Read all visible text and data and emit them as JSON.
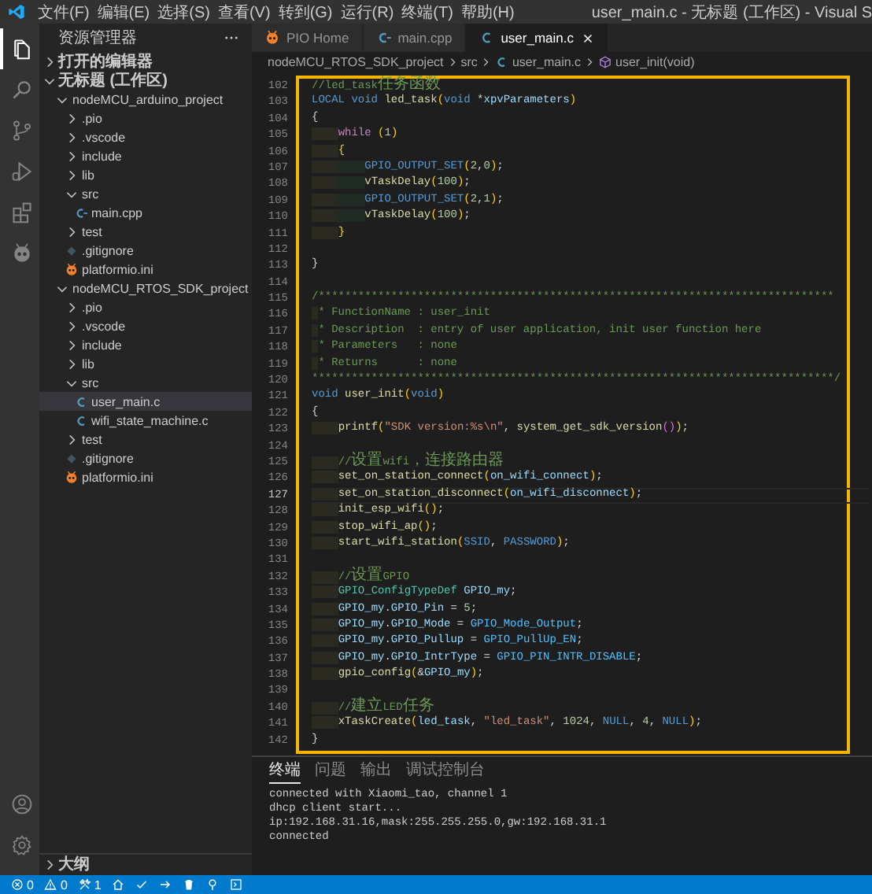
{
  "title_bar": {
    "menu": [
      "文件(F)",
      "编辑(E)",
      "选择(S)",
      "查看(V)",
      "转到(G)",
      "运行(R)",
      "终端(T)",
      "帮助(H)"
    ],
    "title": "user_main.c - 无标题 (工作区) - Visual S"
  },
  "activity_bar": {
    "top": [
      {
        "kind": "explorer",
        "selected": true
      },
      {
        "kind": "search",
        "selected": false
      },
      {
        "kind": "scm",
        "selected": false
      },
      {
        "kind": "run",
        "selected": false
      },
      {
        "kind": "extensions",
        "selected": false
      },
      {
        "kind": "platformio",
        "selected": false
      }
    ],
    "bottom": [
      {
        "kind": "account"
      },
      {
        "kind": "settings"
      }
    ]
  },
  "sidebar": {
    "title": "资源管理器",
    "sections": [
      {
        "label": "打开的编辑器",
        "expanded": false
      },
      {
        "label": "无标题 (工作区)",
        "expanded": true,
        "children": [
          {
            "label": "nodeMCU_arduino_project",
            "kind": "folder",
            "expanded": true,
            "selected": false,
            "children": [
              {
                "label": ".pio",
                "kind": "folder",
                "expanded": false,
                "selected": false
              },
              {
                "label": ".vscode",
                "kind": "folder",
                "expanded": false,
                "selected": false
              },
              {
                "label": "include",
                "kind": "folder",
                "expanded": false,
                "selected": false
              },
              {
                "label": "lib",
                "kind": "folder",
                "expanded": false,
                "selected": false
              },
              {
                "label": "src",
                "kind": "folder",
                "expanded": true,
                "selected": false,
                "children": [
                  {
                    "label": "main.cpp",
                    "kind": "cpp",
                    "selected": false
                  }
                ]
              },
              {
                "label": "test",
                "kind": "folder",
                "expanded": false,
                "selected": false
              },
              {
                "label": ".gitignore",
                "kind": "git",
                "selected": false
              },
              {
                "label": "platformio.ini",
                "kind": "pio",
                "selected": false
              }
            ]
          },
          {
            "label": "nodeMCU_RTOS_SDK_project",
            "kind": "folder",
            "expanded": true,
            "selected": false,
            "children": [
              {
                "label": ".pio",
                "kind": "folder",
                "expanded": false,
                "selected": false
              },
              {
                "label": ".vscode",
                "kind": "folder",
                "expanded": false,
                "selected": false
              },
              {
                "label": "include",
                "kind": "folder",
                "expanded": false,
                "selected": false
              },
              {
                "label": "lib",
                "kind": "folder",
                "expanded": false,
                "selected": false
              },
              {
                "label": "src",
                "kind": "folder",
                "expanded": true,
                "selected": false,
                "children": [
                  {
                    "label": "user_main.c",
                    "kind": "c",
                    "selected": true
                  },
                  {
                    "label": "wifi_state_machine.c",
                    "kind": "c",
                    "selected": false
                  }
                ]
              },
              {
                "label": "test",
                "kind": "folder",
                "expanded": false,
                "selected": false
              },
              {
                "label": ".gitignore",
                "kind": "git",
                "selected": false
              },
              {
                "label": "platformio.ini",
                "kind": "pio",
                "selected": false
              }
            ]
          }
        ]
      },
      {
        "label": "大纲",
        "expanded": false
      }
    ]
  },
  "tabs": [
    {
      "label": "PIO Home",
      "kind": "pio",
      "selected": false
    },
    {
      "label": "main.cpp",
      "kind": "cpp",
      "selected": false
    },
    {
      "label": "user_main.c",
      "kind": "c",
      "selected": true
    }
  ],
  "breadcrumb": [
    {
      "kind": "folder",
      "text": "nodeMCU_RTOS_SDK_project"
    },
    {
      "kind": "folder",
      "text": "src"
    },
    {
      "kind": "c",
      "text": "user_main.c"
    },
    {
      "kind": "function",
      "text": "user_init(void)"
    }
  ],
  "editor": {
    "lines": [
      {
        "number": "102",
        "current": false,
        "tokens": [
          {
            "kind": "comment",
            "text": "//led_task任务函数"
          }
        ]
      },
      {
        "number": "103",
        "current": false,
        "tokens": [
          {
            "kind": "keyword",
            "text": "LOCAL void "
          },
          {
            "kind": "func",
            "text": "led_task"
          },
          {
            "kind": "bracket",
            "text": "("
          },
          {
            "kind": "keyword",
            "text": "void"
          },
          {
            "kind": "plain",
            "text": " *"
          },
          {
            "kind": "var",
            "text": "xpvParameters"
          },
          {
            "kind": "bracket",
            "text": ")"
          }
        ]
      },
      {
        "number": "104",
        "current": false,
        "tokens": [
          {
            "kind": "plain",
            "text": "{"
          }
        ]
      },
      {
        "number": "105",
        "current": false,
        "tokens": [
          {
            "kind": "control",
            "text": "    while "
          },
          {
            "kind": "bracket",
            "text": "("
          },
          {
            "kind": "number",
            "text": "1"
          },
          {
            "kind": "bracket",
            "text": ")"
          }
        ]
      },
      {
        "number": "106",
        "current": false,
        "tokens": [
          {
            "kind": "bracket",
            "text": "    {"
          }
        ]
      },
      {
        "number": "107",
        "current": false,
        "tokens": [
          {
            "kind": "macro",
            "text": "        GPIO_OUTPUT_SET"
          },
          {
            "kind": "bracket",
            "text": "("
          },
          {
            "kind": "number",
            "text": "2"
          },
          {
            "kind": "plain",
            "text": ","
          },
          {
            "kind": "number",
            "text": "0"
          },
          {
            "kind": "bracket",
            "text": ")"
          },
          {
            "kind": "plain",
            "text": ";"
          }
        ]
      },
      {
        "number": "108",
        "current": false,
        "tokens": [
          {
            "kind": "func",
            "text": "        vTaskDelay"
          },
          {
            "kind": "bracket",
            "text": "("
          },
          {
            "kind": "number",
            "text": "100"
          },
          {
            "kind": "bracket",
            "text": ")"
          },
          {
            "kind": "plain",
            "text": ";"
          }
        ]
      },
      {
        "number": "109",
        "current": false,
        "tokens": [
          {
            "kind": "macro",
            "text": "        GPIO_OUTPUT_SET"
          },
          {
            "kind": "bracket",
            "text": "("
          },
          {
            "kind": "number",
            "text": "2"
          },
          {
            "kind": "plain",
            "text": ","
          },
          {
            "kind": "number",
            "text": "1"
          },
          {
            "kind": "bracket",
            "text": ")"
          },
          {
            "kind": "plain",
            "text": ";"
          }
        ]
      },
      {
        "number": "110",
        "current": false,
        "tokens": [
          {
            "kind": "func",
            "text": "        vTaskDelay"
          },
          {
            "kind": "bracket",
            "text": "("
          },
          {
            "kind": "number",
            "text": "100"
          },
          {
            "kind": "bracket",
            "text": ")"
          },
          {
            "kind": "plain",
            "text": ";"
          }
        ]
      },
      {
        "number": "111",
        "current": false,
        "tokens": [
          {
            "kind": "bracket",
            "text": "    }"
          }
        ]
      },
      {
        "number": "112",
        "current": false
      },
      {
        "number": "113",
        "current": false,
        "tokens": [
          {
            "kind": "plain",
            "text": "}"
          }
        ]
      },
      {
        "number": "114",
        "current": false
      },
      {
        "number": "115",
        "current": false,
        "tokens": [
          {
            "kind": "comment",
            "text": "/******************************************************************************"
          }
        ]
      },
      {
        "number": "116",
        "current": false,
        "tokens": [
          {
            "kind": "comment",
            "text": " * FunctionName : user_init"
          }
        ]
      },
      {
        "number": "117",
        "current": false,
        "tokens": [
          {
            "kind": "comment",
            "text": " * Description  : entry of user application, init user function here"
          }
        ]
      },
      {
        "number": "118",
        "current": false,
        "tokens": [
          {
            "kind": "comment",
            "text": " * Parameters   : none"
          }
        ]
      },
      {
        "number": "119",
        "current": false,
        "tokens": [
          {
            "kind": "comment",
            "text": " * Returns      : none"
          }
        ]
      },
      {
        "number": "120",
        "current": false,
        "tokens": [
          {
            "kind": "comment",
            "text": "*******************************************************************************/"
          }
        ]
      },
      {
        "number": "121",
        "current": false,
        "tokens": [
          {
            "kind": "keyword",
            "text": "void "
          },
          {
            "kind": "func",
            "text": "user_init"
          },
          {
            "kind": "bracket",
            "text": "("
          },
          {
            "kind": "keyword",
            "text": "void"
          },
          {
            "kind": "bracket",
            "text": ")"
          }
        ]
      },
      {
        "number": "122",
        "current": false,
        "tokens": [
          {
            "kind": "plain",
            "text": "{"
          }
        ]
      },
      {
        "number": "123",
        "current": false,
        "tokens": [
          {
            "kind": "func",
            "text": "    printf"
          },
          {
            "kind": "bracket",
            "text": "("
          },
          {
            "kind": "string",
            "text": "\"SDK version:%s\\n\""
          },
          {
            "kind": "plain",
            "text": ", "
          },
          {
            "kind": "func",
            "text": "system_get_sdk_version"
          },
          {
            "kind": "bracket2",
            "text": "()"
          },
          {
            "kind": "bracket",
            "text": ")"
          },
          {
            "kind": "plain",
            "text": ";"
          }
        ]
      },
      {
        "number": "124",
        "current": false
      },
      {
        "number": "125",
        "current": false,
        "tokens": [
          {
            "kind": "comment",
            "text": "    //设置wifi，连接路由器"
          }
        ]
      },
      {
        "number": "126",
        "current": false,
        "tokens": [
          {
            "kind": "func",
            "text": "    set_on_station_connect"
          },
          {
            "kind": "bracket",
            "text": "("
          },
          {
            "kind": "var",
            "text": "on_wifi_connect"
          },
          {
            "kind": "bracket",
            "text": ")"
          },
          {
            "kind": "plain",
            "text": ";"
          }
        ]
      },
      {
        "number": "127",
        "current": true,
        "tokens": [
          {
            "kind": "func",
            "text": "    set_on_station_disconnect"
          },
          {
            "kind": "bracket",
            "text": "("
          },
          {
            "kind": "var",
            "text": "on_wifi_disconnect"
          },
          {
            "kind": "bracket",
            "text": ")"
          },
          {
            "kind": "plain",
            "text": ";"
          }
        ]
      },
      {
        "number": "128",
        "current": false,
        "tokens": [
          {
            "kind": "func",
            "text": "    init_esp_wifi"
          },
          {
            "kind": "bracket",
            "text": "()"
          },
          {
            "kind": "plain",
            "text": ";"
          }
        ]
      },
      {
        "number": "129",
        "current": false,
        "tokens": [
          {
            "kind": "func",
            "text": "    stop_wifi_ap"
          },
          {
            "kind": "bracket",
            "text": "()"
          },
          {
            "kind": "plain",
            "text": ";"
          }
        ]
      },
      {
        "number": "130",
        "current": false,
        "tokens": [
          {
            "kind": "func",
            "text": "    start_wifi_station"
          },
          {
            "kind": "bracket",
            "text": "("
          },
          {
            "kind": "macro",
            "text": "SSID"
          },
          {
            "kind": "plain",
            "text": ", "
          },
          {
            "kind": "macro",
            "text": "PASSWORD"
          },
          {
            "kind": "bracket",
            "text": ")"
          },
          {
            "kind": "plain",
            "text": ";"
          }
        ]
      },
      {
        "number": "131",
        "current": false
      },
      {
        "number": "132",
        "current": false,
        "tokens": [
          {
            "kind": "comment",
            "text": "    //设置GPIO"
          }
        ]
      },
      {
        "number": "133",
        "current": false,
        "tokens": [
          {
            "kind": "type",
            "text": "    GPIO_ConfigTypeDef "
          },
          {
            "kind": "var",
            "text": "GPIO_my"
          },
          {
            "kind": "plain",
            "text": ";"
          }
        ]
      },
      {
        "number": "134",
        "current": false,
        "tokens": [
          {
            "kind": "var",
            "text": "    GPIO_my"
          },
          {
            "kind": "plain",
            "text": "."
          },
          {
            "kind": "var",
            "text": "GPIO_Pin"
          },
          {
            "kind": "plain",
            "text": " = "
          },
          {
            "kind": "number",
            "text": "5"
          },
          {
            "kind": "plain",
            "text": ";"
          }
        ]
      },
      {
        "number": "135",
        "current": false,
        "tokens": [
          {
            "kind": "var",
            "text": "    GPIO_my"
          },
          {
            "kind": "plain",
            "text": "."
          },
          {
            "kind": "var",
            "text": "GPIO_Mode"
          },
          {
            "kind": "plain",
            "text": " = "
          },
          {
            "kind": "enum",
            "text": "GPIO_Mode_Output"
          },
          {
            "kind": "plain",
            "text": ";"
          }
        ]
      },
      {
        "number": "136",
        "current": false,
        "tokens": [
          {
            "kind": "var",
            "text": "    GPIO_my"
          },
          {
            "kind": "plain",
            "text": "."
          },
          {
            "kind": "var",
            "text": "GPIO_Pullup"
          },
          {
            "kind": "plain",
            "text": " = "
          },
          {
            "kind": "enum",
            "text": "GPIO_PullUp_EN"
          },
          {
            "kind": "plain",
            "text": ";"
          }
        ]
      },
      {
        "number": "137",
        "current": false,
        "tokens": [
          {
            "kind": "var",
            "text": "    GPIO_my"
          },
          {
            "kind": "plain",
            "text": "."
          },
          {
            "kind": "var",
            "text": "GPIO_IntrType"
          },
          {
            "kind": "plain",
            "text": " = "
          },
          {
            "kind": "enum",
            "text": "GPIO_PIN_INTR_DISABLE"
          },
          {
            "kind": "plain",
            "text": ";"
          }
        ]
      },
      {
        "number": "138",
        "current": false,
        "tokens": [
          {
            "kind": "func",
            "text": "    gpio_config"
          },
          {
            "kind": "bracket",
            "text": "("
          },
          {
            "kind": "plain",
            "text": "&"
          },
          {
            "kind": "var",
            "text": "GPIO_my"
          },
          {
            "kind": "bracket",
            "text": ")"
          },
          {
            "kind": "plain",
            "text": ";"
          }
        ]
      },
      {
        "number": "139",
        "current": false
      },
      {
        "number": "140",
        "current": false,
        "tokens": [
          {
            "kind": "comment",
            "text": "    //建立LED任务"
          }
        ]
      },
      {
        "number": "141",
        "current": false,
        "tokens": [
          {
            "kind": "func",
            "text": "    xTaskCreate"
          },
          {
            "kind": "bracket",
            "text": "("
          },
          {
            "kind": "var",
            "text": "led_task"
          },
          {
            "kind": "plain",
            "text": ", "
          },
          {
            "kind": "string",
            "text": "\"led_task\""
          },
          {
            "kind": "plain",
            "text": ", "
          },
          {
            "kind": "number",
            "text": "1024"
          },
          {
            "kind": "plain",
            "text": ", "
          },
          {
            "kind": "macro",
            "text": "NULL"
          },
          {
            "kind": "plain",
            "text": ", "
          },
          {
            "kind": "number",
            "text": "4"
          },
          {
            "kind": "plain",
            "text": ", "
          },
          {
            "kind": "macro",
            "text": "NULL"
          },
          {
            "kind": "bracket",
            "text": ")"
          },
          {
            "kind": "plain",
            "text": ";"
          }
        ]
      },
      {
        "number": "142",
        "current": false,
        "tokens": [
          {
            "kind": "plain",
            "text": "}"
          }
        ]
      }
    ]
  },
  "panel": {
    "tabs": [
      {
        "label": "终端",
        "selected": true
      },
      {
        "label": "问题",
        "selected": false
      },
      {
        "label": "输出",
        "selected": false
      },
      {
        "label": "调试控制台",
        "selected": false
      }
    ],
    "terminal_lines": [
      "connected with Xiaomi_tao, channel 1",
      "dhcp client start...",
      "ip:192.168.31.16,mask:255.255.255.0,gw:192.168.31.1",
      "connected"
    ]
  },
  "status_bar": [
    {
      "kind": "errors",
      "text": "0"
    },
    {
      "kind": "warnings",
      "text": "0"
    },
    {
      "kind": "tools",
      "text": "1"
    },
    {
      "kind": "home"
    },
    {
      "kind": "build"
    },
    {
      "kind": "upload"
    },
    {
      "kind": "clean"
    },
    {
      "kind": "plug"
    },
    {
      "kind": "terminal"
    }
  ]
}
